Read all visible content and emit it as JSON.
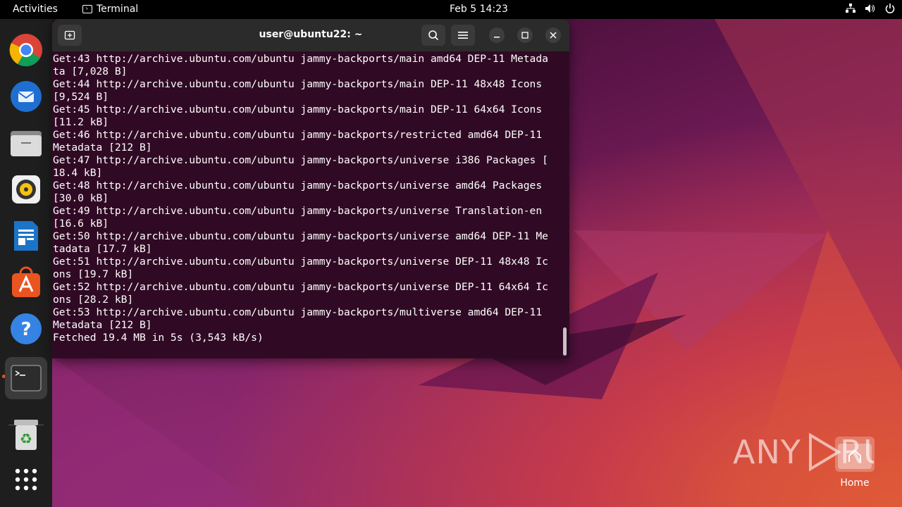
{
  "topbar": {
    "activities": "Activities",
    "app_name": "Terminal",
    "clock": "Feb 5  14:23",
    "tray_icons": [
      "network-icon",
      "volume-icon",
      "power-icon"
    ]
  },
  "dock": {
    "items": [
      {
        "name": "chrome-icon"
      },
      {
        "name": "thunderbird-icon"
      },
      {
        "name": "files-icon"
      },
      {
        "name": "rhythmbox-icon"
      },
      {
        "name": "writer-icon"
      },
      {
        "name": "app-center-icon"
      },
      {
        "name": "help-icon"
      },
      {
        "name": "terminal-icon",
        "active": true
      },
      {
        "name": "trash-icon"
      },
      {
        "name": "show-apps-icon"
      }
    ]
  },
  "terminal": {
    "title": "user@ubuntu22: ~",
    "lines": [
      "Get:43 http://archive.ubuntu.com/ubuntu jammy-backports/main amd64 DEP-11 Metada",
      "ta [7,028 B]",
      "Get:44 http://archive.ubuntu.com/ubuntu jammy-backports/main DEP-11 48x48 Icons",
      "[9,524 B]",
      "Get:45 http://archive.ubuntu.com/ubuntu jammy-backports/main DEP-11 64x64 Icons",
      "[11.2 kB]",
      "Get:46 http://archive.ubuntu.com/ubuntu jammy-backports/restricted amd64 DEP-11",
      "Metadata [212 B]",
      "Get:47 http://archive.ubuntu.com/ubuntu jammy-backports/universe i386 Packages [",
      "18.4 kB]",
      "Get:48 http://archive.ubuntu.com/ubuntu jammy-backports/universe amd64 Packages",
      "[30.0 kB]",
      "Get:49 http://archive.ubuntu.com/ubuntu jammy-backports/universe Translation-en",
      "[16.6 kB]",
      "Get:50 http://archive.ubuntu.com/ubuntu jammy-backports/universe amd64 DEP-11 Me",
      "tadata [17.7 kB]",
      "Get:51 http://archive.ubuntu.com/ubuntu jammy-backports/universe DEP-11 48x48 Ic",
      "ons [19.7 kB]",
      "Get:52 http://archive.ubuntu.com/ubuntu jammy-backports/universe DEP-11 64x64 Ic",
      "ons [28.2 kB]",
      "Get:53 http://archive.ubuntu.com/ubuntu jammy-backports/multiverse amd64 DEP-11",
      "Metadata [212 B]",
      "Fetched 19.4 MB in 5s (3,543 kB/s)"
    ]
  },
  "desktop": {
    "home_label": "Home"
  },
  "watermark": "ANY RUN",
  "colors": {
    "terminal_bg": "#300a24",
    "accent": "#e95420"
  }
}
